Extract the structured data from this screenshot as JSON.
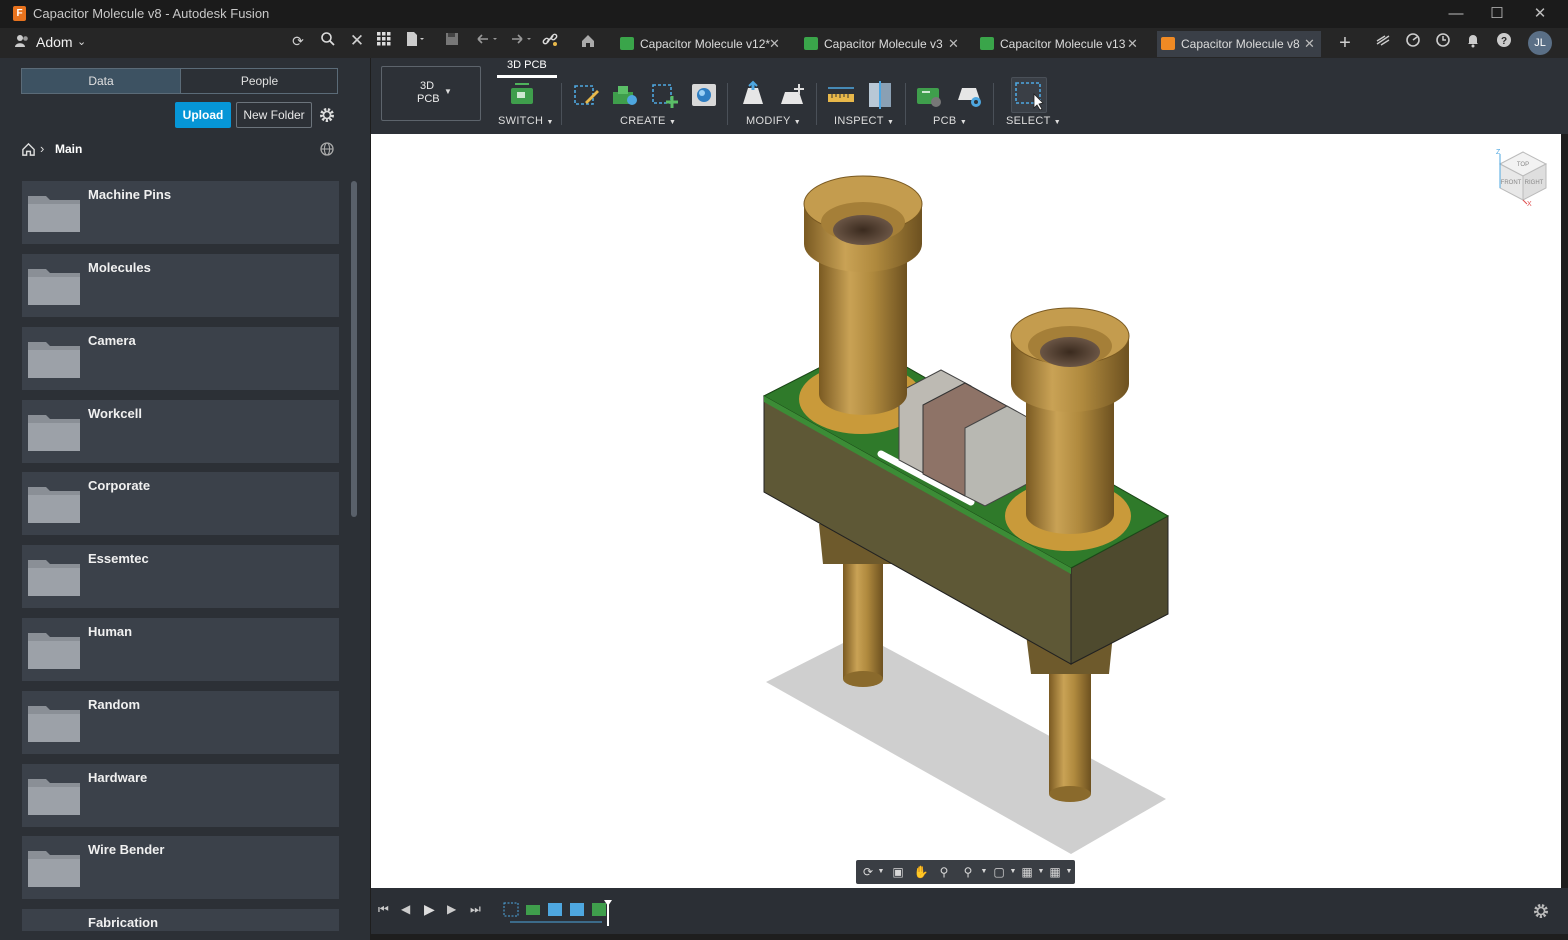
{
  "window": {
    "title": "Capacitor Molecule v8 - Autodesk Fusion",
    "minimize_icon": "minimize-icon",
    "maximize_icon": "maximize-icon",
    "close_icon": "close-icon"
  },
  "appbar": {
    "team_name": "Adom",
    "user_initials": "JL",
    "tabs": [
      {
        "label": "Capacitor Molecule v12*",
        "icon": "pcb-document-icon",
        "icon_color": "#3aa54a"
      },
      {
        "label": "Capacitor Molecule v3",
        "icon": "schematic-document-icon",
        "icon_color": "#3aa54a"
      },
      {
        "label": "Capacitor Molecule v13",
        "icon": "board-document-icon",
        "icon_color": "#3aa54a"
      },
      {
        "label": "Capacitor Molecule v8",
        "icon": "3d-pcb-document-icon",
        "icon_color": "#f08a24"
      }
    ]
  },
  "data_panel": {
    "segments": [
      "Data",
      "People"
    ],
    "upload_label": "Upload",
    "new_folder_label": "New Folder",
    "breadcrumb": "Main",
    "folders": [
      "Machine Pins",
      "Molecules",
      "Camera",
      "Workcell",
      "Corporate",
      "Essemtec",
      "Human",
      "Random",
      "Hardware",
      "Wire Bender",
      "Fabrication"
    ]
  },
  "toolbar": {
    "workspace_label_1": "3D",
    "workspace_label_2": "PCB",
    "active_tab": "3D PCB",
    "groups": [
      "SWITCH",
      "CREATE",
      "MODIFY",
      "INSPECT",
      "PCB",
      "SELECT"
    ]
  },
  "viewcube": {
    "faces": [
      "TOP",
      "FRONT",
      "RIGHT"
    ],
    "axes": [
      "Z",
      "X"
    ]
  },
  "colors": {
    "accent": "#0696d7",
    "pcb_green": "#2e7d2e",
    "brass": "#b08a3e",
    "board_body": "#5b5535"
  }
}
